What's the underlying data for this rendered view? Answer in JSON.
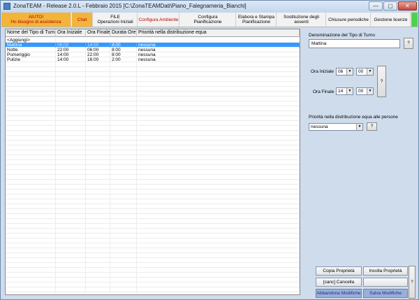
{
  "window": {
    "title": "ZonaTEAM - Release 2.0.L - Febbraio 2015 [C:\\ZonaTEAMDati\\Piano_Falegnameria_Bianchi]",
    "min_glyph": "—",
    "max_glyph": "▢",
    "close_glyph": "✕"
  },
  "toolbar": {
    "help": [
      "AIUTO!",
      "Ho bisogno di assistenza"
    ],
    "chat": "Chat",
    "file": [
      "FILE",
      "Operazioni Iniziali"
    ],
    "ambiente": "Configura Ambiente",
    "pianificazione": [
      "Configura",
      "Pianificazione"
    ],
    "elabora": [
      "Elabora e Stampa",
      "Pianificazione"
    ],
    "sostituzione": [
      "Sostituzione degli",
      "assenti"
    ],
    "chiusure": "Chiusure periodiche",
    "licenze": "Gestione licenze"
  },
  "grid": {
    "columns": [
      "Nome del Tipo di Turno",
      "Ora Iniziale",
      "Ora Finale",
      "Durata Ore",
      "Priorità nella distribuzione equa"
    ],
    "add_row": "<Aggiungi>",
    "rows": [
      {
        "name": "Mattina",
        "start": "06:00",
        "end": "14:00",
        "duration": "8:00",
        "priority": "nessuna",
        "selected": true
      },
      {
        "name": "Notte",
        "start": "22:00",
        "end": "06:00",
        "duration": "8:00",
        "priority": "nessuna",
        "selected": false
      },
      {
        "name": "Pomeriggio",
        "start": "14:00",
        "end": "22:00",
        "duration": "8:00",
        "priority": "nessuna",
        "selected": false
      },
      {
        "name": "Pulizie",
        "start": "14:00",
        "end": "16:00",
        "duration": "2:00",
        "priority": "nessuna",
        "selected": false
      }
    ]
  },
  "panel": {
    "denominazione_label": "Denominazione del Tipo di Turno",
    "denominazione_value": "Mattina",
    "help_q": "?",
    "ora_iniziale_label": "Ora Iniziale",
    "ora_iniziale_h": "06",
    "ora_iniziale_m": "00",
    "ora_finale_label": "Ora Finale",
    "ora_finale_h": "14",
    "ora_finale_m": "00",
    "priorita_label": "Priorità nella distribuzione equa alle persone",
    "priorita_value": "nessuna"
  },
  "actions": {
    "copia": "Copia Proprietà",
    "incolla": "Incolla Proprietà",
    "cancella": "[canc] Cancella",
    "abbandona": "Abbandona Modifiche",
    "salva": "Salva Modifiche",
    "side_q": "?"
  },
  "colors": {
    "selection": "#3399ff",
    "help_bg": "#f3b43a",
    "accent_red": "#c00000",
    "save_blue": "#9ab0d8"
  }
}
